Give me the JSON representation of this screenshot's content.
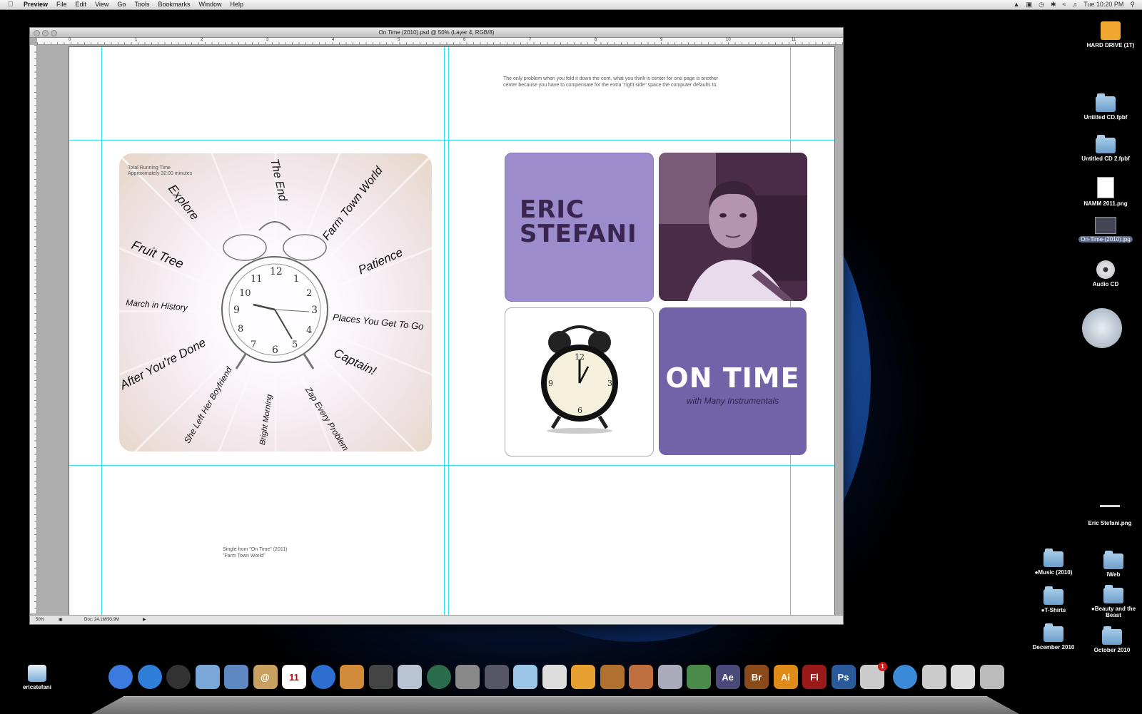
{
  "menubar": {
    "apple": "",
    "app_name": "Preview",
    "items": [
      "File",
      "Edit",
      "View",
      "Go",
      "Tools",
      "Bookmarks",
      "Window",
      "Help"
    ],
    "clock": "Tue 10:20 PM"
  },
  "window": {
    "title": "On Time (2010).psd @ 50% (Layer 4, RGB/8)",
    "zoom": "50%",
    "doc_info": "Doc: 24.1M/93.9M",
    "ruler_numbers": [
      "0",
      "1",
      "2",
      "3",
      "4",
      "5",
      "6",
      "7",
      "8",
      "9",
      "10",
      "11"
    ]
  },
  "canvas": {
    "note_text": "The only problem when you fold it down the cent, what you think is center for one page is another center because you have to compensate for the extra \"right side\" space the computer defaults to.",
    "single_text": "Single from \"On Time\" (2011)\n\"Farm Town World\"",
    "running_time": "Total Running Time\nApproximately 32:00 minutes",
    "tracks": [
      "Explore",
      "The End",
      "Farm Town World",
      "Patience",
      "Fruit Tree",
      "March in History",
      "Places You Get To Go",
      "After You're Done",
      "Captain!",
      "She Left Her Boyfriend",
      "Bright Morning",
      "Zap Every Problem"
    ],
    "artist_name": "ERIC\nSTEFANI",
    "album_title": "ON TIME",
    "album_subtitle": "with Many Instrumentals",
    "panel_color_name": "#9c8ccc",
    "panel_color_title": "#7262a8"
  },
  "desktop_icons": [
    {
      "label": "HARD DRIVE (1T)",
      "icon": "hard-drive-icon"
    },
    {
      "label": "Untitled CD.fpbf",
      "icon": "burn-folder-icon"
    },
    {
      "label": "Untitled CD 2.fpbf",
      "icon": "burn-folder-icon"
    },
    {
      "label": "NAMM 2011.png",
      "icon": "image-file-icon"
    },
    {
      "label": "On-Time-(2010).jpg",
      "icon": "image-file-icon"
    },
    {
      "label": "Audio CD",
      "icon": "cd-icon"
    },
    {
      "label": "Eric Stefani.png",
      "icon": "image-file-icon"
    },
    {
      "label": "●Music (2010)",
      "icon": "folder-icon"
    },
    {
      "label": "iWeb",
      "icon": "folder-icon"
    },
    {
      "label": "●T-Shirts",
      "icon": "folder-icon"
    },
    {
      "label": "●Beauty and the Beast",
      "icon": "folder-icon"
    },
    {
      "label": "December 2010",
      "icon": "folder-icon"
    },
    {
      "label": "October 2010",
      "icon": "folder-icon"
    },
    {
      "label": "ericstefani",
      "icon": "cloud-drive-icon"
    }
  ],
  "dock": {
    "items": [
      {
        "name": "finder",
        "label": "",
        "color": "#3b7be0"
      },
      {
        "name": "app-store",
        "label": "",
        "color": "#2f7fd8"
      },
      {
        "name": "dashboard",
        "label": "",
        "color": "#333"
      },
      {
        "name": "iphoto",
        "label": "",
        "color": "#7aa6d8"
      },
      {
        "name": "mail",
        "label": "",
        "color": "#5d88c2"
      },
      {
        "name": "address-book",
        "label": "@",
        "color": "#c8a060"
      },
      {
        "name": "ical",
        "label": "11",
        "color": "#ffffff"
      },
      {
        "name": "itunes",
        "label": "",
        "color": "#2d6fd0"
      },
      {
        "name": "iphoto-2",
        "label": "",
        "color": "#d08a3a"
      },
      {
        "name": "imovie",
        "label": "",
        "color": "#444"
      },
      {
        "name": "preview",
        "label": "",
        "color": "#b8c4d4"
      },
      {
        "name": "time-machine",
        "label": "",
        "color": "#2a6c4c"
      },
      {
        "name": "system-preferences",
        "label": "",
        "color": "#888"
      },
      {
        "name": "expose",
        "label": "",
        "color": "#556"
      },
      {
        "name": "textedit",
        "label": "",
        "color": "#9bc6e8"
      },
      {
        "name": "pages",
        "label": "",
        "color": "#ddd"
      },
      {
        "name": "keynote",
        "label": "",
        "color": "#e8a030"
      },
      {
        "name": "garageband",
        "label": "",
        "color": "#b07030"
      },
      {
        "name": "keynote-2",
        "label": "",
        "color": "#c07040"
      },
      {
        "name": "script-editor",
        "label": "",
        "color": "#aab"
      },
      {
        "name": "numbers",
        "label": "",
        "color": "#4a8a4a"
      },
      {
        "name": "after-effects",
        "label": "Ae",
        "color": "#4a4a7a"
      },
      {
        "name": "bridge",
        "label": "Br",
        "color": "#8a4a1a"
      },
      {
        "name": "illustrator",
        "label": "Ai",
        "color": "#e08a1a"
      },
      {
        "name": "flash",
        "label": "Fl",
        "color": "#9a1a1a"
      },
      {
        "name": "photoshop",
        "label": "Ps",
        "color": "#2a5a9a"
      },
      {
        "name": "printer",
        "label": "",
        "color": "#ccc"
      },
      {
        "name": "safari",
        "label": "",
        "color": "#3a8ad8"
      },
      {
        "name": "stack-1",
        "label": "",
        "color": "#ccc"
      },
      {
        "name": "stack-2",
        "label": "",
        "color": "#ddd"
      },
      {
        "name": "trash",
        "label": "",
        "color": "#bbb"
      }
    ],
    "printer_badge": "1"
  }
}
